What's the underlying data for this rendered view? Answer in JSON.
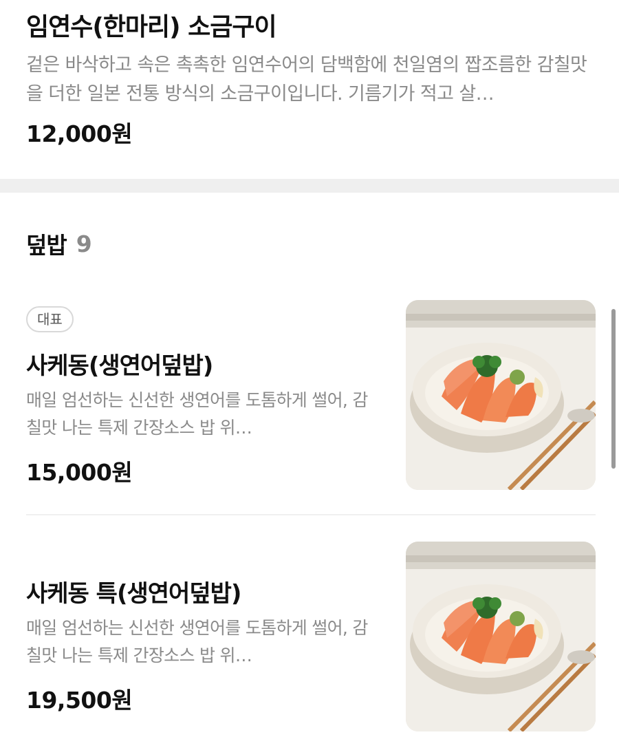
{
  "top_item": {
    "name": "임연수(한마리) 소금구이",
    "description": "겉은 바삭하고 속은 촉촉한 임연수어의 담백함에 천일염의 짭조름한 감칠맛을 더한 일본 전통 방식의 소금구이입니다. 기름기가 적고 살…",
    "price": "12,000원"
  },
  "section": {
    "title": "덮밥",
    "count": "9"
  },
  "items": [
    {
      "badge": "대표",
      "name": "사케동(생연어덮밥)",
      "description": "매일 엄선하는 신선한 생연어를 도톰하게 썰어, 감칠맛 나는 특제 간장소스 밥 위…",
      "price": "15,000원",
      "photo_icon": "salmon-rice-bowl-photo"
    },
    {
      "name": "사케동 특(생연어덮밥)",
      "description": "매일 엄선하는 신선한 생연어를 도톰하게 썰어, 감칠맛 나는 특제 간장소스 밥 위…",
      "price": "19,500원",
      "photo_icon": "salmon-rice-bowl-photo"
    }
  ],
  "colors": {
    "text_primary": "#111111",
    "text_secondary": "#8a8a8a",
    "section_divider": "#efefef",
    "salmon": "#f07a4a"
  }
}
